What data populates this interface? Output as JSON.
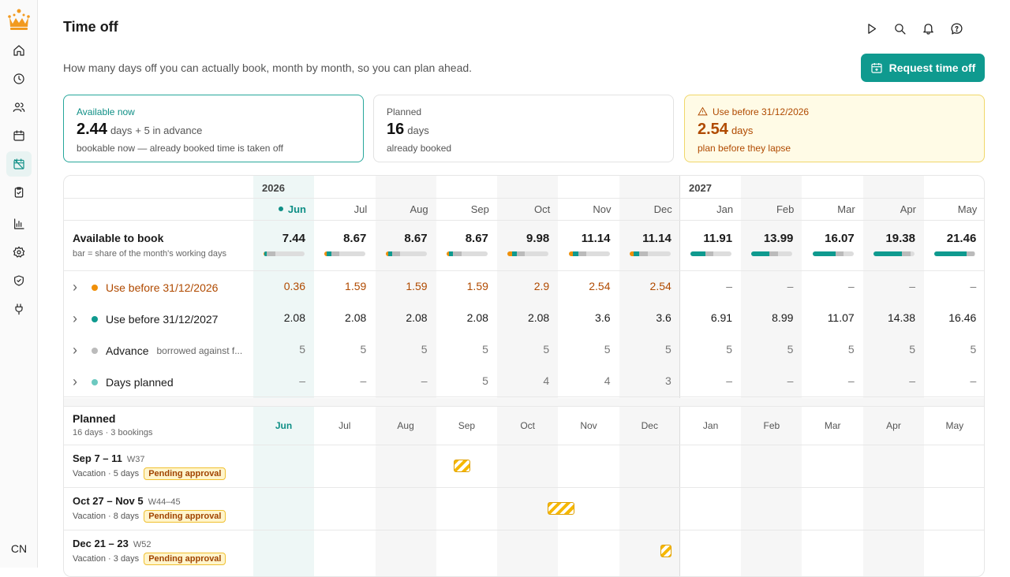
{
  "page": {
    "title": "Time off",
    "subtitle": "How many days off you can actually book, month by month, so you can plan ahead.",
    "request_button": "Request time off"
  },
  "user": {
    "initials": "CN"
  },
  "colors": {
    "accent": "#0f9a8f",
    "warning": "#b04a00",
    "pending": "#f6b800",
    "advance": "#bbbbbb",
    "planned": "#6cc9c0"
  },
  "sidebar": {
    "items": [
      "home-icon",
      "clock-icon",
      "users-icon",
      "calendar-icon",
      "calendar-off-icon",
      "clipboard-check-icon",
      "chart-icon",
      "gear-icon",
      "shield-check-icon",
      "plug-icon"
    ]
  },
  "cards": [
    {
      "label": "Available now",
      "value": "2.44",
      "unit": "days",
      "extra": "+ 5 in advance",
      "sub": "bookable now — already booked time is taken off"
    },
    {
      "label": "Planned",
      "value": "16",
      "unit": "days",
      "extra": "",
      "sub": "already booked"
    },
    {
      "label": "Use before 31/12/2026",
      "value": "2.54",
      "unit": "days",
      "extra": "",
      "sub": "plan before they lapse"
    }
  ],
  "years": [
    "2026",
    "2027"
  ],
  "months": [
    "Jun",
    "Jul",
    "Aug",
    "Sep",
    "Oct",
    "Nov",
    "Dec",
    "Jan",
    "Feb",
    "Mar",
    "Apr",
    "May"
  ],
  "available": {
    "title": "Available to book",
    "sub": "bar = share of the month's working days",
    "values": [
      "7.44",
      "8.67",
      "8.67",
      "8.67",
      "9.98",
      "11.14",
      "11.14",
      "11.91",
      "13.99",
      "16.07",
      "19.38",
      "21.46"
    ],
    "bars": [
      {
        "orange": 0.02,
        "teal": 0.06,
        "gray": 0.2
      },
      {
        "orange": 0.06,
        "teal": 0.1,
        "gray": 0.2
      },
      {
        "orange": 0.06,
        "teal": 0.1,
        "gray": 0.2
      },
      {
        "orange": 0.06,
        "teal": 0.1,
        "gray": 0.2
      },
      {
        "orange": 0.12,
        "teal": 0.1,
        "gray": 0.2
      },
      {
        "orange": 0.1,
        "teal": 0.14,
        "gray": 0.2
      },
      {
        "orange": 0.1,
        "teal": 0.14,
        "gray": 0.2
      },
      {
        "orange": 0,
        "teal": 0.36,
        "gray": 0.2
      },
      {
        "orange": 0,
        "teal": 0.44,
        "gray": 0.2
      },
      {
        "orange": 0,
        "teal": 0.56,
        "gray": 0.2
      },
      {
        "orange": 0,
        "teal": 0.7,
        "gray": 0.2
      },
      {
        "orange": 0,
        "teal": 0.78,
        "gray": 0.2
      }
    ]
  },
  "rows": [
    {
      "label": "Use before 31/12/2026",
      "note": "",
      "dot": "#f0900a",
      "style": "orange",
      "values": [
        "0.36",
        "1.59",
        "1.59",
        "1.59",
        "2.9",
        "2.54",
        "2.54",
        "–",
        "–",
        "–",
        "–",
        "–"
      ]
    },
    {
      "label": "Use before 31/12/2027",
      "note": "",
      "dot": "#0f9a8f",
      "style": "dark",
      "values": [
        "2.08",
        "2.08",
        "2.08",
        "2.08",
        "2.08",
        "3.6",
        "3.6",
        "6.91",
        "8.99",
        "11.07",
        "14.38",
        "16.46"
      ]
    },
    {
      "label": "Advance",
      "note": "borrowed against f...",
      "dot": "#bbbbbb",
      "style": "gray",
      "values": [
        "5",
        "5",
        "5",
        "5",
        "5",
        "5",
        "5",
        "5",
        "5",
        "5",
        "5",
        "5"
      ]
    },
    {
      "label": "Days planned",
      "note": "",
      "dot": "#6cc9c0",
      "style": "gray",
      "values": [
        "–",
        "–",
        "–",
        "5",
        "4",
        "4",
        "3",
        "–",
        "–",
        "–",
        "–",
        "–"
      ]
    }
  ],
  "planned": {
    "title": "Planned",
    "sub": "16 days · 3 bookings",
    "bookings": [
      {
        "dates": "Sep 7 – 11",
        "week": "W37",
        "detail": "Vacation · 5 days",
        "status": "Pending approval",
        "month": 3,
        "start": 0.28,
        "span": 0.28
      },
      {
        "dates": "Oct 27 – Nov 5",
        "week": "W44–45",
        "detail": "Vacation · 8 days",
        "status": "Pending approval",
        "month": 4,
        "start": 0.82,
        "span": 0.45
      },
      {
        "dates": "Dec 21 – 23",
        "week": "W52",
        "detail": "Vacation · 3 days",
        "status": "Pending approval",
        "month": 6,
        "start": 0.68,
        "span": 0.18
      }
    ]
  }
}
